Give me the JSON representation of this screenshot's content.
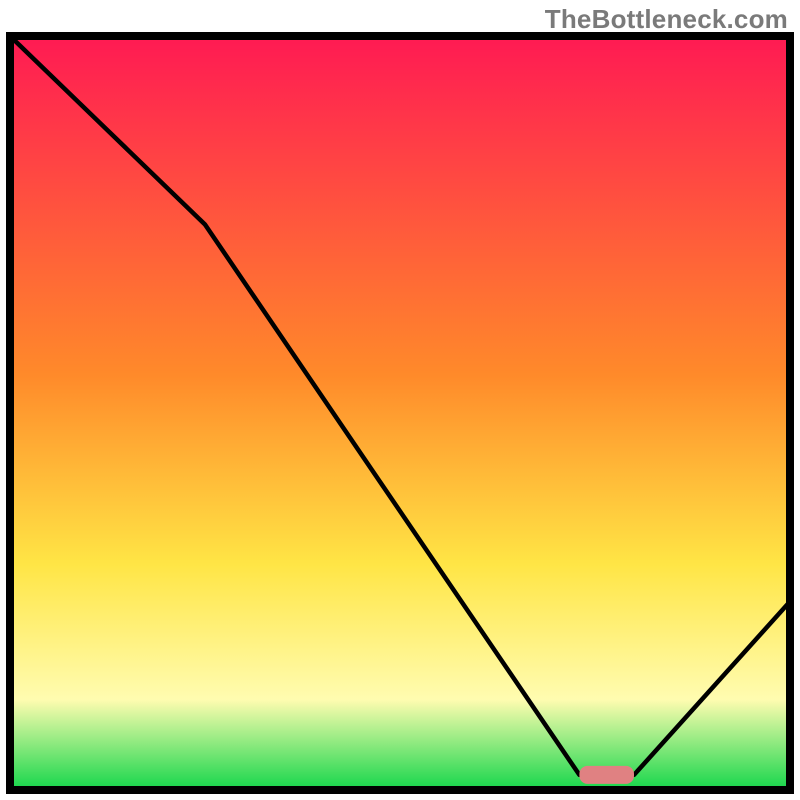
{
  "watermark": "TheBottleneck.com",
  "colors": {
    "gradient_top": "#ff1a53",
    "gradient_mid1": "#ff8a2a",
    "gradient_mid2": "#ffe545",
    "gradient_mid3": "#fffcb0",
    "gradient_bottom": "#15d64b",
    "curve": "#000000",
    "marker_fill": "#e08182",
    "frame": "#000000"
  },
  "chart_data": {
    "type": "line",
    "title": "",
    "xlabel": "",
    "ylabel": "",
    "xlim": [
      0,
      100
    ],
    "ylim": [
      0,
      100
    ],
    "grid": false,
    "legend": false,
    "series": [
      {
        "name": "bottleneck-curve",
        "x": [
          0,
          25,
          73,
          80,
          100
        ],
        "values": [
          100,
          75,
          2,
          2,
          25
        ]
      }
    ],
    "marker": {
      "x_start": 73,
      "x_end": 80,
      "y": 2,
      "shape": "rounded-bar"
    },
    "gradient_stops_percent_from_top": {
      "red": 0,
      "orange": 45,
      "yellow": 70,
      "pale_yellow": 88,
      "green": 100
    }
  }
}
